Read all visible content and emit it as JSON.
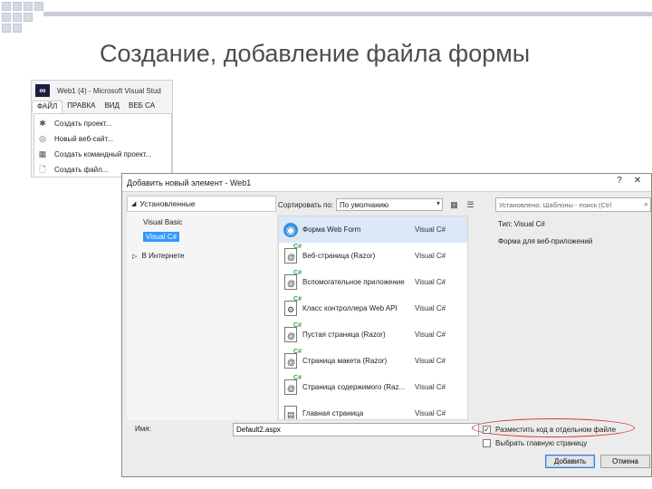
{
  "slide": {
    "title": "Создание, добавление файла формы"
  },
  "vs_window": {
    "title": "Web1 (4) - Microsoft Visual Stud",
    "menu": [
      "ФАЙЛ",
      "ПРАВКА",
      "ВИД",
      "ВЕБ СА"
    ],
    "file_menu_items": [
      {
        "label": "Создать проект...",
        "icon": "new-project-icon"
      },
      {
        "label": "Новый веб-сайт...",
        "icon": "globe-icon"
      },
      {
        "label": "Создать командный проект...",
        "icon": "team-project-icon"
      },
      {
        "label": "Создать файл...",
        "icon": "new-file-icon"
      }
    ]
  },
  "dialog": {
    "title": "Добавить новый элемент - Web1",
    "tree": {
      "header": "Установленные",
      "items": [
        "Visual Basic",
        "Visual C#"
      ],
      "selected": "Visual C#",
      "online": "В Интернете"
    },
    "sort_label": "Сортировать по:",
    "sort_value": "По умолчанию",
    "search_placeholder": "Установлено: Шаблоны - поиск (Ctrl",
    "templates": [
      {
        "name": "Форма Web Form",
        "lang": "Visual C#",
        "selected": true,
        "icon": "globe-icon"
      },
      {
        "name": "Веб-страница (Razor)",
        "lang": "Visual C#",
        "icon": "razor-file-icon"
      },
      {
        "name": "Вспомогательное приложение",
        "lang": "Visual C#",
        "icon": "helper-file-icon"
      },
      {
        "name": "Класс контроллера Web API",
        "lang": "Visual C#",
        "icon": "controller-file-icon"
      },
      {
        "name": "Пустая страница (Razor)",
        "lang": "Visual C#",
        "icon": "razor-file-icon"
      },
      {
        "name": "Страница макета (Razor)",
        "lang": "Visual C#",
        "icon": "razor-file-icon"
      },
      {
        "name": "Страница содержимого (Raz...",
        "lang": "Visual C#",
        "icon": "razor-file-icon"
      },
      {
        "name": "Главная страница",
        "lang": "Visual C#",
        "icon": "master-page-icon"
      }
    ],
    "info": {
      "type_label": "Тип: Visual C#",
      "description": "Форма для веб-приложений"
    },
    "name_label": "Имя:",
    "name_value": "Default2.aspx",
    "options": [
      {
        "label": "Разместить код в отдельном файле",
        "checked": true
      },
      {
        "label": "Выбрать главную страницу",
        "checked": false
      }
    ],
    "add_button": "Добавить",
    "cancel_button": "Отмена"
  }
}
